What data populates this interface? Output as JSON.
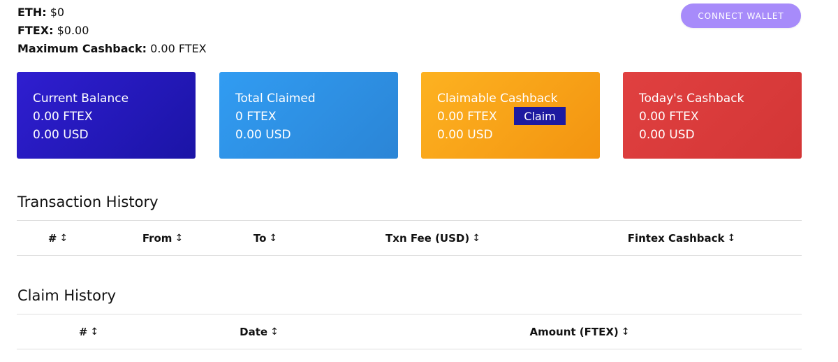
{
  "wallet": {
    "eth_label": "ETH:",
    "eth_value": "$0",
    "ftex_label": "FTEX:",
    "ftex_value": "$0.00",
    "max_cashback_label": "Maximum Cashback:",
    "max_cashback_value": "0.00 FTEX",
    "connect_label": "CONNECT WALLET"
  },
  "cards": [
    {
      "title": "Current Balance",
      "line1": "0.00 FTEX",
      "line2": "0.00 USD"
    },
    {
      "title": "Total Claimed",
      "line1": "0 FTEX",
      "line2": "0.00 USD"
    },
    {
      "title": "Claimable Cashback",
      "line1": "0.00 FTEX",
      "line2": "0.00 USD",
      "button": "Claim"
    },
    {
      "title": "Today's Cashback",
      "line1": "0.00 FTEX",
      "line2": "0.00 USD"
    }
  ],
  "transaction_history": {
    "title": "Transaction History",
    "columns": [
      "#",
      "From",
      "To",
      "Txn Fee (USD)",
      "Fintex Cashback"
    ],
    "rows": []
  },
  "claim_history": {
    "title": "Claim History",
    "columns": [
      "#",
      "Date",
      "Amount (FTEX)"
    ],
    "rows": []
  },
  "icons": {
    "sort": "↕"
  },
  "colors": {
    "connect_button": "#a78bfa",
    "card_balance": "#2218b8",
    "card_claimed": "#2e90e4",
    "card_claimable": "#f7a318",
    "card_today": "#d93b3b",
    "claim_button": "#1d1aa0"
  }
}
